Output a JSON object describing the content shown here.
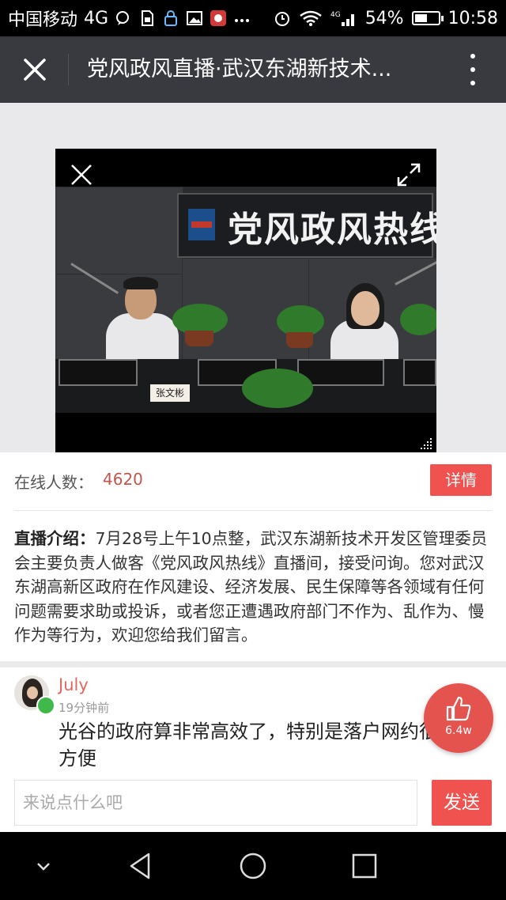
{
  "status_bar": {
    "carrier": "中国移动",
    "network": "4G",
    "battery_percent": "54%",
    "battery_level": 0.54,
    "time": "10:58",
    "icons": [
      "chat-bubble-icon",
      "sim-card-icon",
      "lock-icon",
      "image-icon",
      "app-notification-icon",
      "more-dots-icon",
      "alarm-icon",
      "wifi-icon",
      "signal-icon",
      "battery-icon"
    ]
  },
  "title_bar": {
    "title": "党风政风直播·武汉东湖新技术...",
    "close_icon": "close-icon",
    "more_icon": "more-vertical-icon"
  },
  "video": {
    "sign_text": "党风政风热线",
    "nameplate": "张文彬",
    "close_icon": "close-icon",
    "expand_icon": "expand-icon",
    "grip_icon": "resize-grip-icon"
  },
  "info": {
    "online_label": "在线人数：",
    "online_count": "4620",
    "detail_button": "详情"
  },
  "intro": {
    "label": "直播介绍：",
    "text": "7月28号上午10点整，武汉东湖新技术开发区管理委员会主要负责人做客《党风政风热线》直播间，接受问询。您对武汉东湖高新区政府在作风建设、经济发展、民生保障等各领域有任何问题需要求助或投诉，或者您正遭遇政府部门不作为、乱作为、慢作为等行为，欢迎您给我们留言。"
  },
  "comment": {
    "user": "July",
    "time": "19分钟前",
    "text": "光谷的政府算非常高效了，特别是落户网约很方便"
  },
  "like": {
    "count": "6.4w",
    "icon": "thumbs-up-icon"
  },
  "input": {
    "placeholder": "来说点什么吧",
    "value": "",
    "send_button": "发送"
  },
  "colors": {
    "accent": "#f0524f",
    "title_bar": "#393a3f",
    "username": "#e0685f"
  }
}
